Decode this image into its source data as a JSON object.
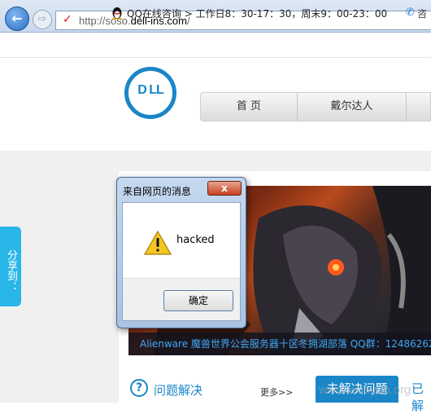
{
  "browser": {
    "back_glyph": "←",
    "forward_glyph": "⇨",
    "url_prefix": "http://soso.",
    "url_domain": "dell-ins.com",
    "url_suffix": "/"
  },
  "topbar": {
    "qq_text": "QQ在线咨询 > 工作日8：30-17：30，周末9：00-23：00",
    "phone_text": "咨"
  },
  "header": {
    "logo_text": "D LL",
    "nav": [
      {
        "label": "首 页"
      },
      {
        "label": "戴尔达人"
      }
    ]
  },
  "share_tab": {
    "label": "分享到："
  },
  "banner": {
    "caption": "Alienware 魔兽世界公会服务器十区冬拥湖部落 QQ群：12486262"
  },
  "section": {
    "help_icon": "?",
    "title": "问题解决",
    "more": "更多>>",
    "tab_unsolved": "未解决问题",
    "tab_solved": "已解"
  },
  "watermark": "www.wooyun.org",
  "dialog": {
    "title": "来自网页的消息",
    "close_glyph": "x",
    "message": "hacked",
    "ok_label": "确定"
  },
  "colors": {
    "accent": "#1a86c8",
    "share_tab": "#29b6e8",
    "page_bg": "#f0f0f0"
  }
}
